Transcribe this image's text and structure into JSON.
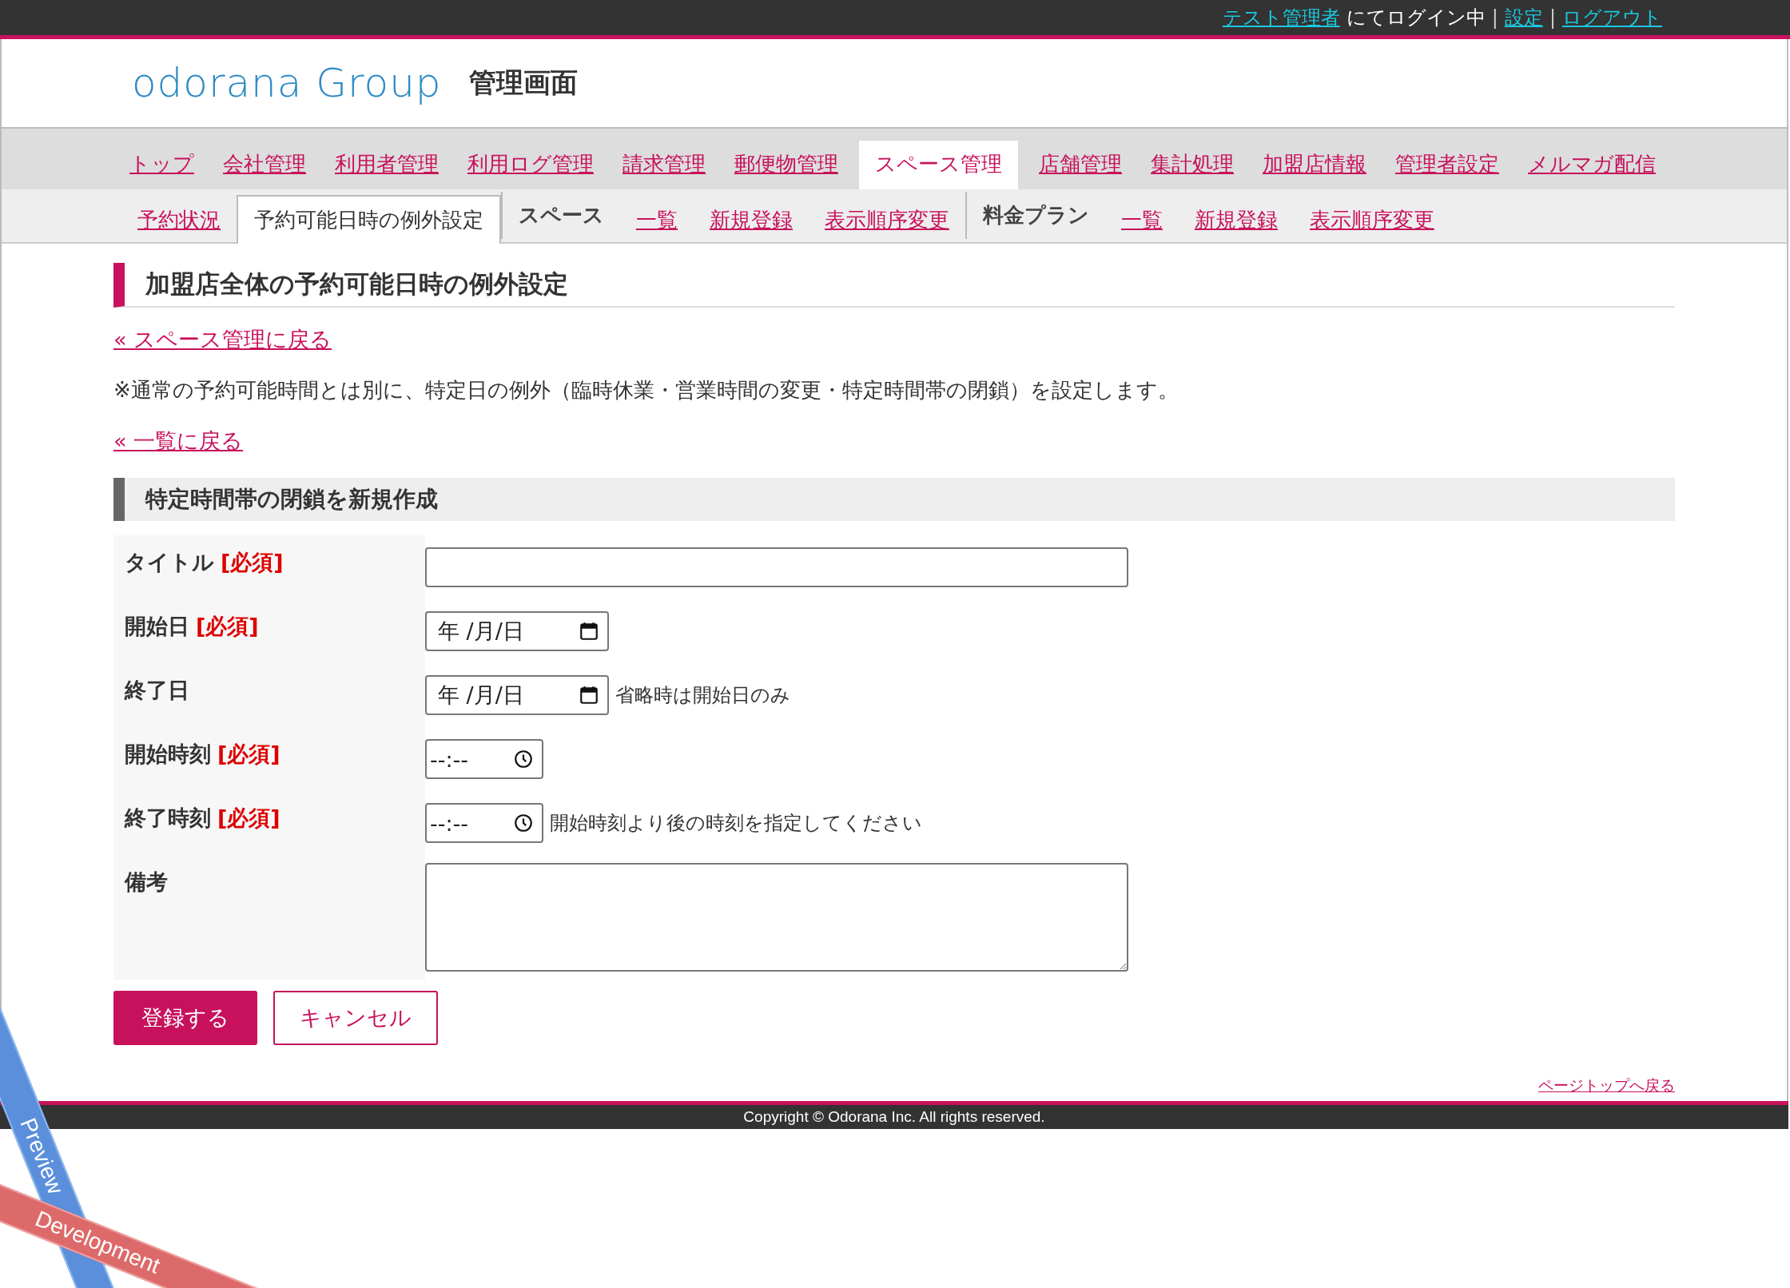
{
  "top_bar": {
    "items": [
      {
        "kind": "link",
        "text": "テスト管理者"
      },
      {
        "kind": "text",
        "text": "にてログイン中"
      },
      {
        "kind": "sep",
        "text": "|"
      },
      {
        "kind": "link",
        "text": "設定"
      },
      {
        "kind": "sep",
        "text": "|"
      },
      {
        "kind": "link",
        "text": "ログアウト"
      }
    ]
  },
  "header": {
    "logo": "odorana Group",
    "subtitle": "管理画面"
  },
  "main_nav": [
    {
      "label": "トップ",
      "selected": false
    },
    {
      "label": "会社管理",
      "selected": false
    },
    {
      "label": "利用者管理",
      "selected": false
    },
    {
      "label": "利用ログ管理",
      "selected": false
    },
    {
      "label": "請求管理",
      "selected": false
    },
    {
      "label": "郵便物管理",
      "selected": false
    },
    {
      "label": "スペース管理",
      "selected": true
    },
    {
      "label": "店舗管理",
      "selected": false
    },
    {
      "label": "集計処理",
      "selected": false
    },
    {
      "label": "加盟店情報",
      "selected": false
    },
    {
      "label": "管理者設定",
      "selected": false
    },
    {
      "label": "メルマガ配信",
      "selected": false
    }
  ],
  "sub_nav": [
    {
      "kind": "link",
      "label": "予約状況",
      "selected": false
    },
    {
      "kind": "link",
      "label": "予約可能日時の例外設定",
      "selected": true
    },
    {
      "kind": "group",
      "label": "スペース",
      "selected": false
    },
    {
      "kind": "link",
      "label": "一覧",
      "selected": false
    },
    {
      "kind": "link",
      "label": "新規登録",
      "selected": false
    },
    {
      "kind": "link",
      "label": "表示順序変更",
      "selected": false
    },
    {
      "kind": "group",
      "label": "料金プラン",
      "selected": false
    },
    {
      "kind": "link",
      "label": "一覧",
      "selected": false
    },
    {
      "kind": "link",
      "label": "新規登録",
      "selected": false
    },
    {
      "kind": "link",
      "label": "表示順序変更",
      "selected": false
    }
  ],
  "page_title": "加盟店全体の予約可能日時の例外設定",
  "back_link": "« スペース管理に戻る",
  "note": "※通常の予約可能時間とは別に、特定日の例外（臨時休業・営業時間の変更・特定時間帯の閉鎖）を設定します。",
  "list_link": "« 一覧に戻る",
  "section_title": "特定時間帯の閉鎖を新規作成",
  "form": {
    "fields": [
      {
        "kind": "text",
        "label": "タイトル",
        "required": "[必須]"
      },
      {
        "kind": "date",
        "label": "開始日",
        "required": "[必須]",
        "placeholder": "年 /月/日"
      },
      {
        "kind": "date",
        "label": "終了日",
        "placeholder": "年 /月/日",
        "hint": "省略時は開始日のみ"
      },
      {
        "kind": "time",
        "label": "開始時刻",
        "required": "[必須]",
        "placeholder": "--:--"
      },
      {
        "kind": "time",
        "label": "終了時刻",
        "required": "[必須]",
        "placeholder": "--:--",
        "hint": "開始時刻より後の時刻を指定してください"
      },
      {
        "kind": "textarea",
        "label": "備考"
      }
    ]
  },
  "buttons": [
    {
      "kind": "primary",
      "label": "登録する"
    },
    {
      "kind": "secondary",
      "label": "キャンセル"
    }
  ],
  "page_top_link": "ページトップへ戻る",
  "footer": {
    "copyright": "Copyright © Odorana Inc. All rights reserved."
  },
  "ribbons": [
    {
      "kind": "preview",
      "text": "Preview"
    },
    {
      "kind": "development",
      "text": "Development"
    }
  ]
}
